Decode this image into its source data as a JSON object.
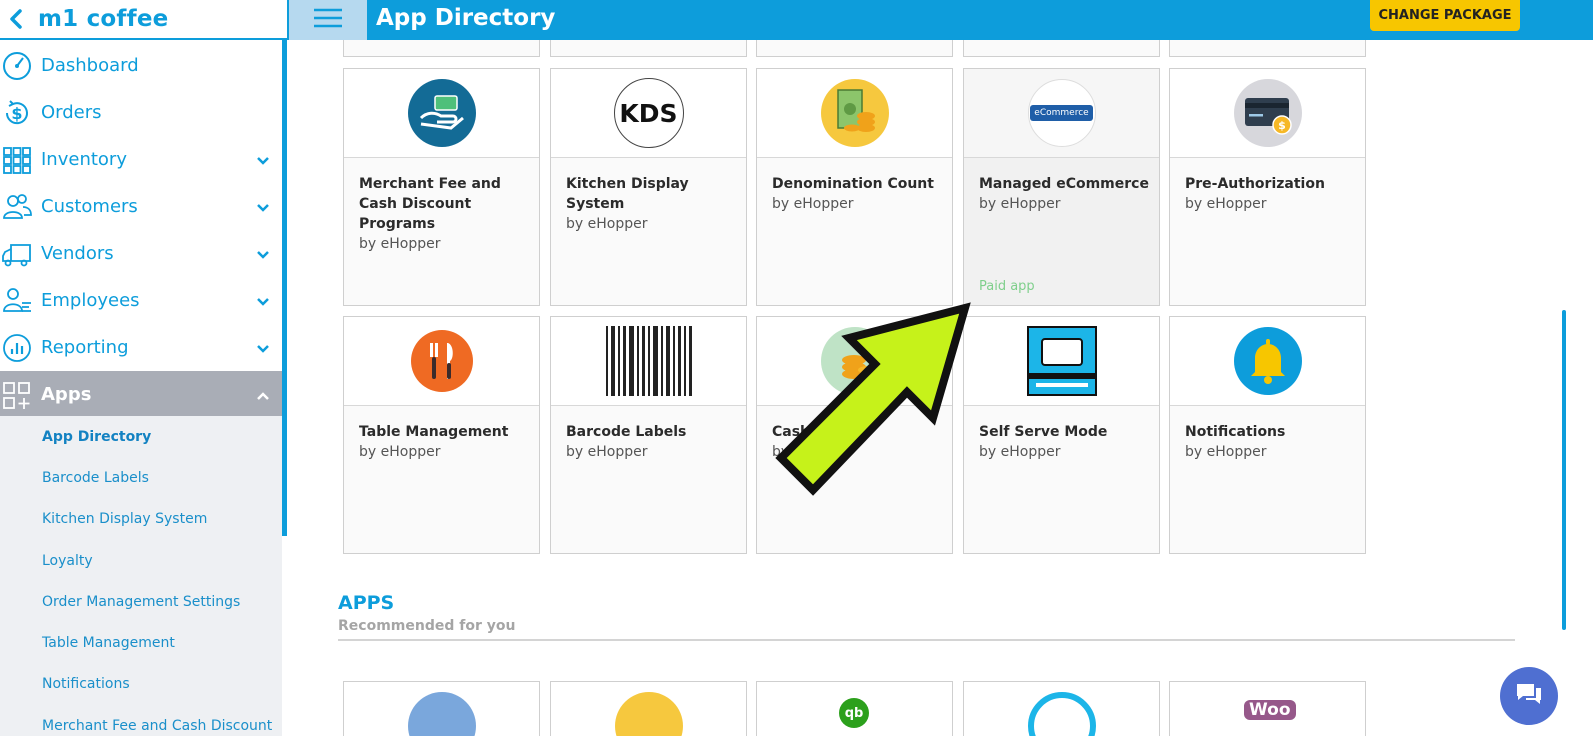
{
  "sidebar": {
    "store_name": "m1 coffee",
    "nav": [
      {
        "label": "Dashboard"
      },
      {
        "label": "Orders"
      },
      {
        "label": "Inventory"
      },
      {
        "label": "Customers"
      },
      {
        "label": "Vendors"
      },
      {
        "label": "Employees"
      },
      {
        "label": "Reporting"
      },
      {
        "label": "Apps"
      }
    ],
    "apps_sub": [
      {
        "label": "App Directory"
      },
      {
        "label": "Barcode Labels"
      },
      {
        "label": "Kitchen Display System"
      },
      {
        "label": "Loyalty"
      },
      {
        "label": "Order Management Settings"
      },
      {
        "label": "Table Management"
      },
      {
        "label": "Notifications"
      },
      {
        "label": "Merchant Fee and Cash Discount"
      }
    ]
  },
  "header": {
    "title": "App Directory",
    "change_package": "CHANGE PACKAGE"
  },
  "apps": {
    "row1": [
      {
        "title": "Merchant Fee and Cash Discount Programs",
        "by": "by eHopper"
      },
      {
        "title": "Kitchen Display System",
        "by": "by eHopper",
        "icon_text": "KDS"
      },
      {
        "title": "Denomination Count",
        "by": "by eHopper"
      },
      {
        "title": "Managed eCommerce",
        "by": "by eHopper",
        "icon_text": "eCommerce",
        "badge": "Paid app"
      },
      {
        "title": "Pre-Authorization",
        "by": "by eHopper"
      }
    ],
    "row2": [
      {
        "title": "Table Management",
        "by": "by eHopper"
      },
      {
        "title": "Barcode Labels",
        "by": "by eHopper"
      },
      {
        "title": "Cash",
        "by": "by"
      },
      {
        "title": "Self Serve Mode",
        "by": "by eHopper"
      },
      {
        "title": "Notifications",
        "by": "by eHopper"
      }
    ]
  },
  "recommended": {
    "title": "APPS",
    "subtitle": "Recommended for you",
    "woo_text": "Woo",
    "qb_text": "qb"
  },
  "colors": {
    "accent": "#0d9ddb",
    "button_yellow": "#f7c600",
    "paid_green": "#7fcf8c",
    "arrow_green": "#c6f21a"
  }
}
